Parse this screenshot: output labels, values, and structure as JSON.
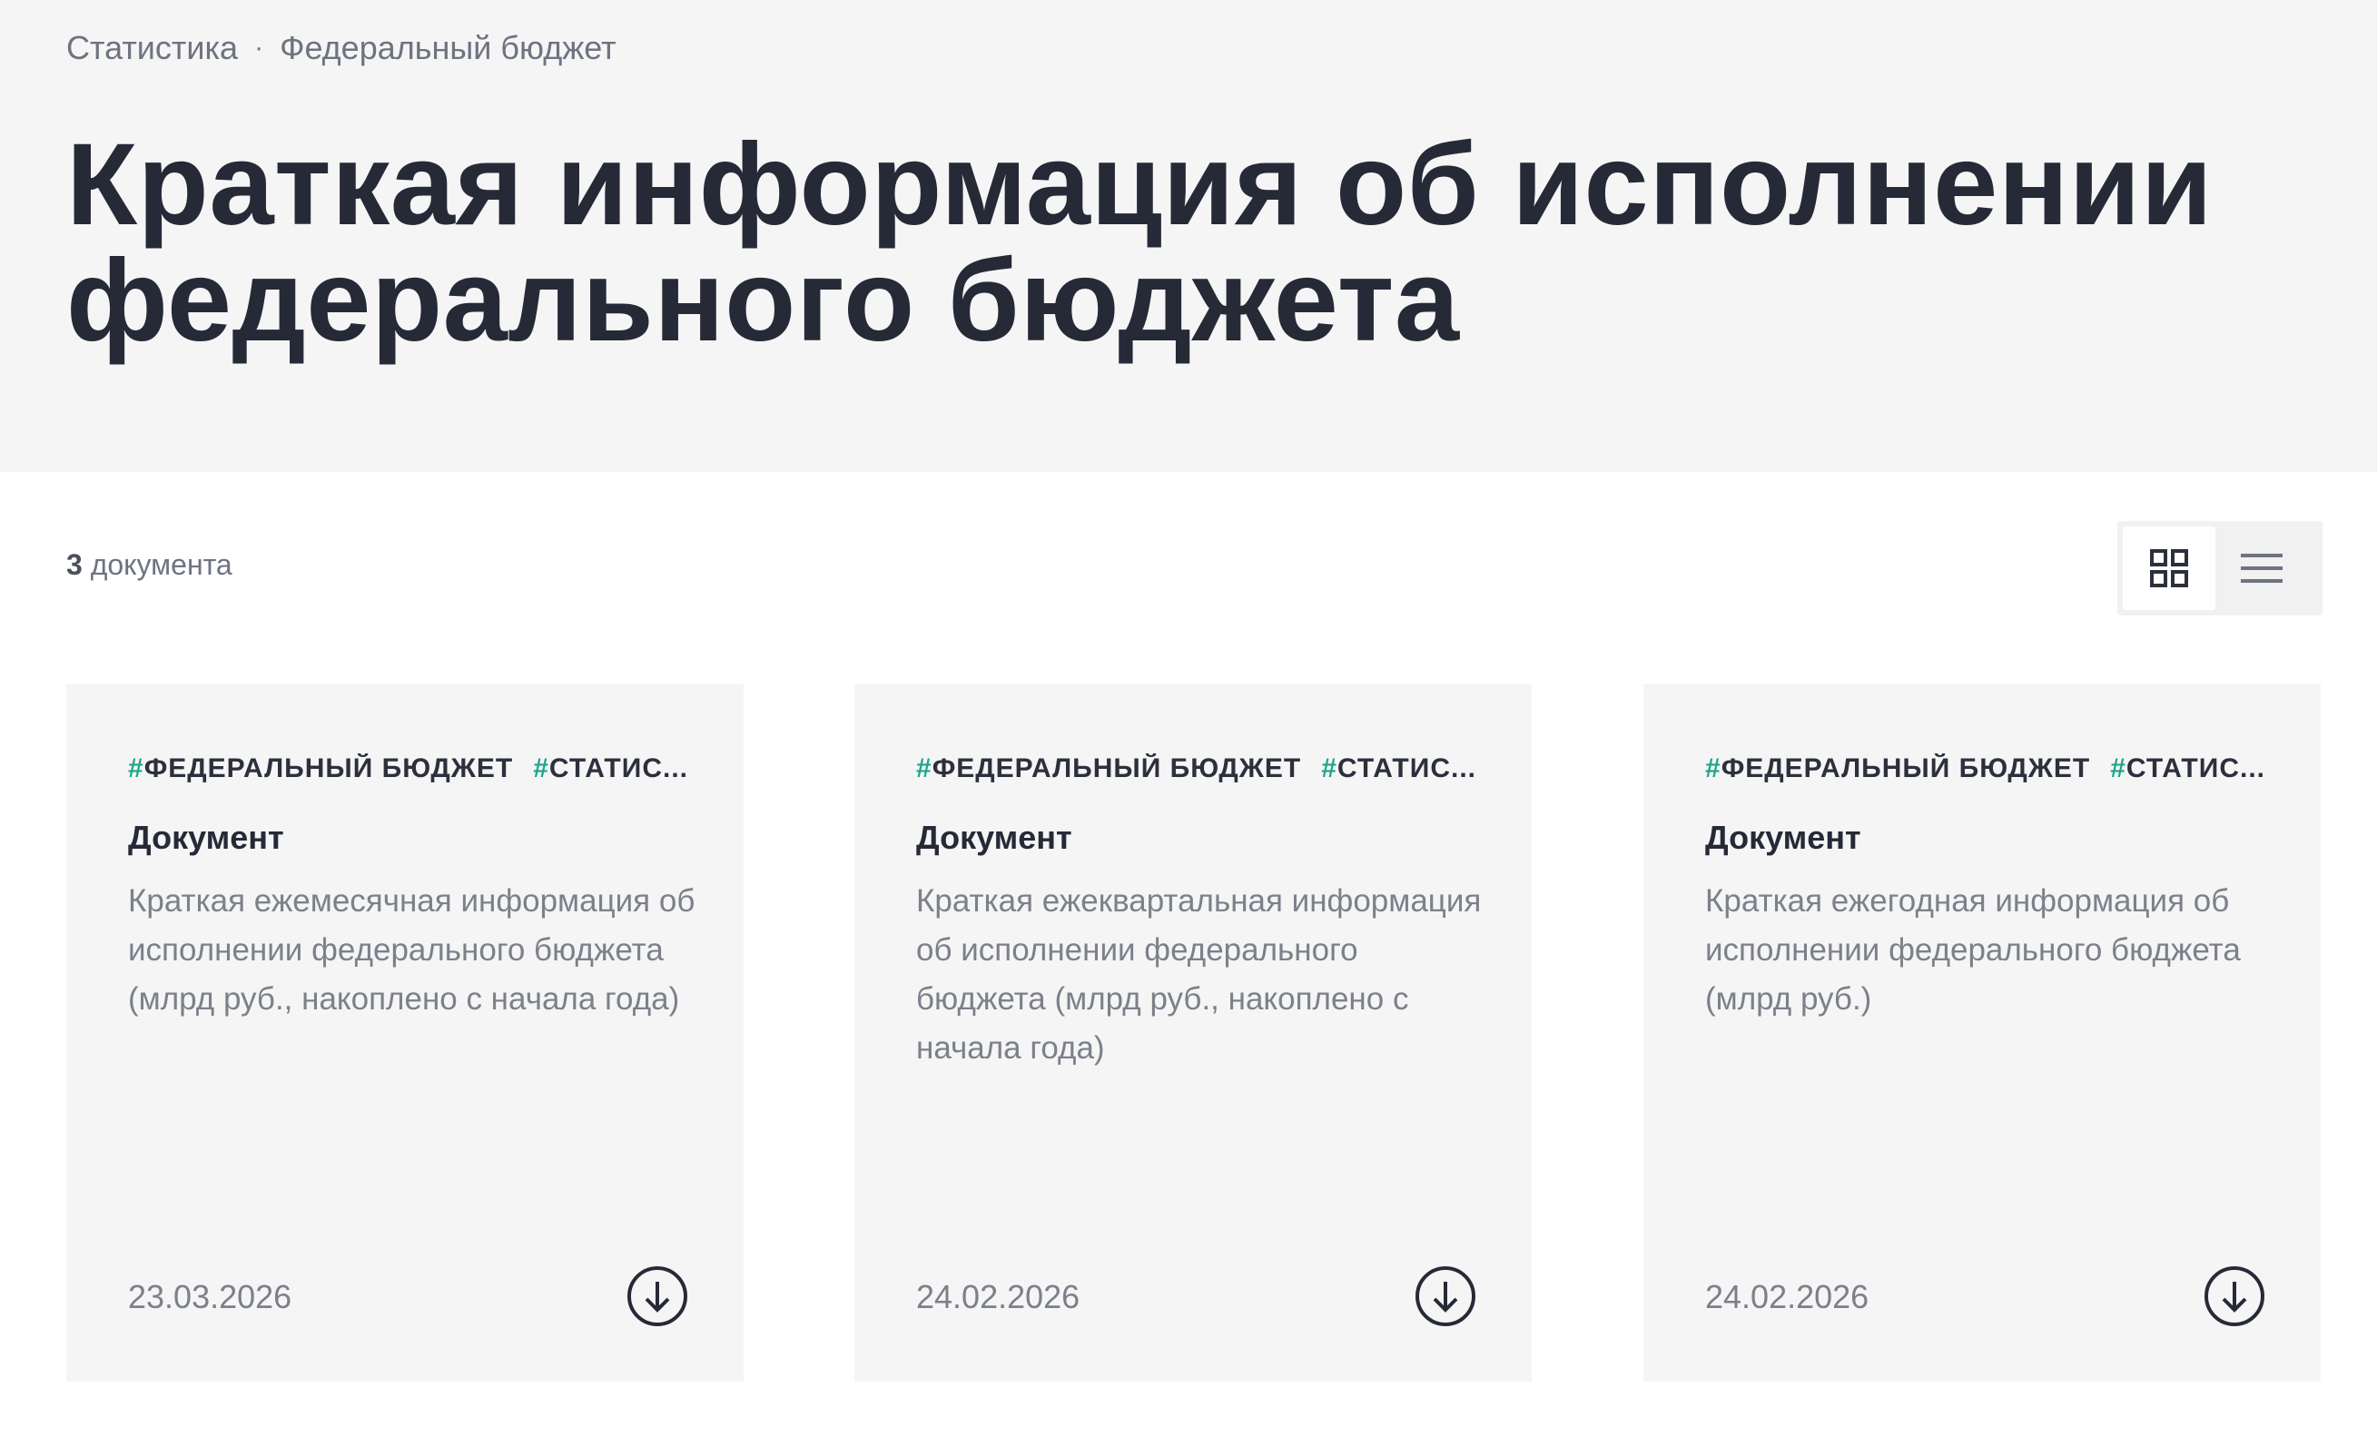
{
  "breadcrumb": {
    "items": [
      "Статистика",
      "Федеральный бюджет"
    ],
    "separator": "·"
  },
  "page": {
    "title": "Краткая информация об исполнении федерального бюджета"
  },
  "toolbar": {
    "count_number": "3",
    "count_label": "документа",
    "view_modes": [
      {
        "icon": "grid-view-icon",
        "active": true
      },
      {
        "icon": "list-view-icon",
        "active": false
      }
    ]
  },
  "cards": [
    {
      "tags": [
        "ФЕДЕРАЛЬНЫЙ БЮДЖЕТ",
        "СТАТИС..."
      ],
      "type": "Документ",
      "description": "Краткая ежемесячная информация об исполнении федерального бюджета (млрд руб., накоплено с начала года)",
      "date": "23.03.2026",
      "action_icon": "download-icon"
    },
    {
      "tags": [
        "ФЕДЕРАЛЬНЫЙ БЮДЖЕТ",
        "СТАТИС..."
      ],
      "type": "Документ",
      "description": "Краткая ежеквартальная информация об исполнении федерального бюджета (млрд руб., накоплено с начала года)",
      "date": "24.02.2026",
      "action_icon": "download-icon"
    },
    {
      "tags": [
        "ФЕДЕРАЛЬНЫЙ БЮДЖЕТ",
        "СТАТИС..."
      ],
      "type": "Документ",
      "description": "Краткая ежегодная информация об исполнении федерального бюджета (млрд руб.)",
      "date": "24.02.2026",
      "action_icon": "download-icon"
    }
  ],
  "colors": {
    "hero_bg": "#f5f5f6",
    "title": "#262a37",
    "muted_text": "#7c8089",
    "tag_hash": "#1fa58a",
    "card_bg": "#f5f5f6"
  }
}
